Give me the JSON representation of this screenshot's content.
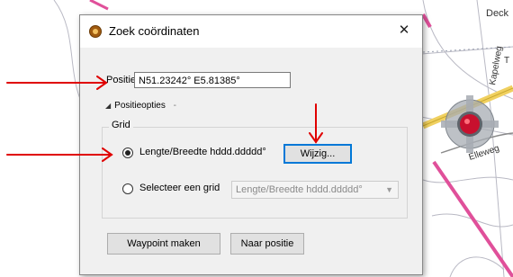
{
  "map": {
    "labels": [
      "Deck",
      "Kapelweg",
      "Elleweg"
    ],
    "edge_label": "T"
  },
  "dialog": {
    "title": "Zoek coördinaten",
    "close_glyph": "✕",
    "position_label": "Positie",
    "position_value": "N51.23242° E5.81385°",
    "options_expander": "Positieopties",
    "options_dash": "-",
    "grid_group_label": "Grid",
    "radio_current_label": "Lengte/Breedte hddd.ddddd°",
    "radio_current_selected": true,
    "change_button": "Wijzig...",
    "radio_select_label": "Selecteer een grid",
    "radio_select_selected": false,
    "grid_select_value": "Lengte/Breedte hddd.ddddd°",
    "waypoint_button": "Waypoint maken",
    "goto_button": "Naar positie"
  },
  "colors": {
    "annotation_arrow": "#e00000",
    "focus_border": "#0078d7",
    "route_line": "#e0509a",
    "marker_red": "#c8102e"
  }
}
